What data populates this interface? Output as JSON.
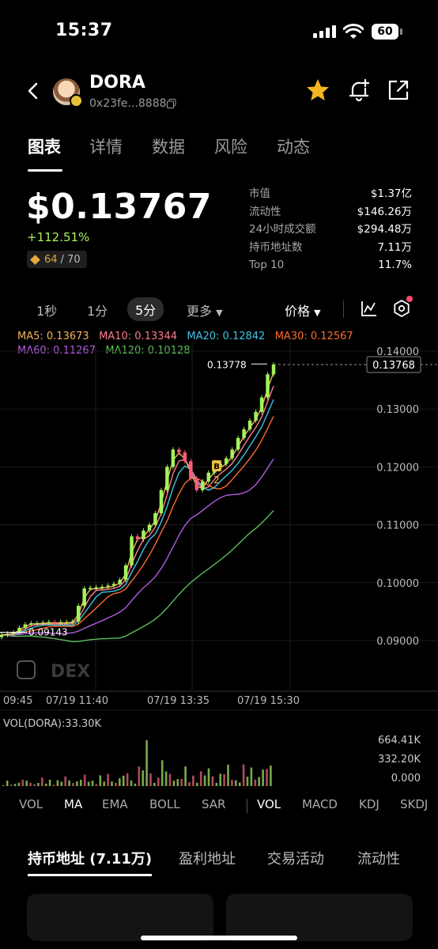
{
  "status": {
    "time": "15:37",
    "battery": "60"
  },
  "header": {
    "name": "DORA",
    "address": "0x23fe...8888"
  },
  "tabs": [
    "图表",
    "详情",
    "数据",
    "风险",
    "动态"
  ],
  "price": {
    "value": "$0.13767",
    "change": "+112.51%",
    "score": "64",
    "score_max": "/ 70"
  },
  "stats": [
    {
      "k": "市值",
      "v": "$1.37亿"
    },
    {
      "k": "流动性",
      "v": "$146.26万"
    },
    {
      "k": "24小时成交额",
      "v": "$294.48万"
    },
    {
      "k": "持币地址数",
      "v": "7.11万"
    },
    {
      "k": "Top 10",
      "v": "11.7%"
    }
  ],
  "timeframes": {
    "t1": "1秒",
    "t2": "1分",
    "t3": "5分",
    "more": "更多",
    "price": "价格"
  },
  "ma": {
    "ma5": "MA5: 0.13673",
    "ma10": "MA10: 0.13344",
    "ma20": "MA20: 0.12842",
    "ma30": "MA30: 0.12567",
    "ma60": "MA60: 0.11267",
    "ma120": "MA120: 0.10128"
  },
  "colors": {
    "up": "#a4f35b",
    "down": "#ff5b7a",
    "ma5": "#f2b35a",
    "ma10": "#ff7b8a",
    "ma20": "#40c4e8",
    "ma30": "#ff6a2a",
    "ma60": "#b45be0",
    "ma120": "#5bbf5b"
  },
  "chart": {
    "yticks": [
      "0.14000",
      "0.13000",
      "0.12000",
      "0.11000",
      "0.10000",
      "0.09000"
    ],
    "current_label": "0.13768",
    "high_label": "0.13778",
    "low_label": "0.09143",
    "xticks": [
      "09:45",
      "07/19 11:40",
      "07/19 13:35",
      "07/19 15:30"
    ],
    "watermark": "DEX",
    "marker_b": "B",
    "marker_2": "2"
  },
  "chart_data": {
    "type": "candlestick",
    "x_range": [
      "09:45",
      "15:35"
    ],
    "ylim": [
      0.085,
      0.141
    ],
    "close_prices": [
      0.091,
      0.0912,
      0.0914,
      0.0922,
      0.0928,
      0.093,
      0.093,
      0.0931,
      0.0932,
      0.0931,
      0.0932,
      0.0932,
      0.0933,
      0.096,
      0.099,
      0.0991,
      0.0992,
      0.0993,
      0.0995,
      0.0998,
      0.1005,
      0.103,
      0.108,
      0.1075,
      0.109,
      0.11,
      0.112,
      0.116,
      0.12,
      0.123,
      0.1225,
      0.121,
      0.118,
      0.116,
      0.1175,
      0.119,
      0.12,
      0.1205,
      0.1215,
      0.123,
      0.125,
      0.1265,
      0.128,
      0.1295,
      0.132,
      0.136,
      0.1377
    ]
  },
  "volume": {
    "label": "VOL(DORA):33.30K",
    "ticks": [
      "664.41K",
      "332.20K",
      "0.000"
    ]
  },
  "indicators": {
    "vol": "VOL",
    "ma": "MA",
    "ema": "EMA",
    "boll": "BOLL",
    "sar": "SAR",
    "vol2": "VOL",
    "macd": "MACD",
    "kdj": "KDJ",
    "skdj": "SKDJ"
  },
  "bottom_tabs": {
    "holders": "持币地址 (7.11万)",
    "profit": "盈利地址",
    "trades": "交易活动",
    "liquidity": "流动性"
  }
}
